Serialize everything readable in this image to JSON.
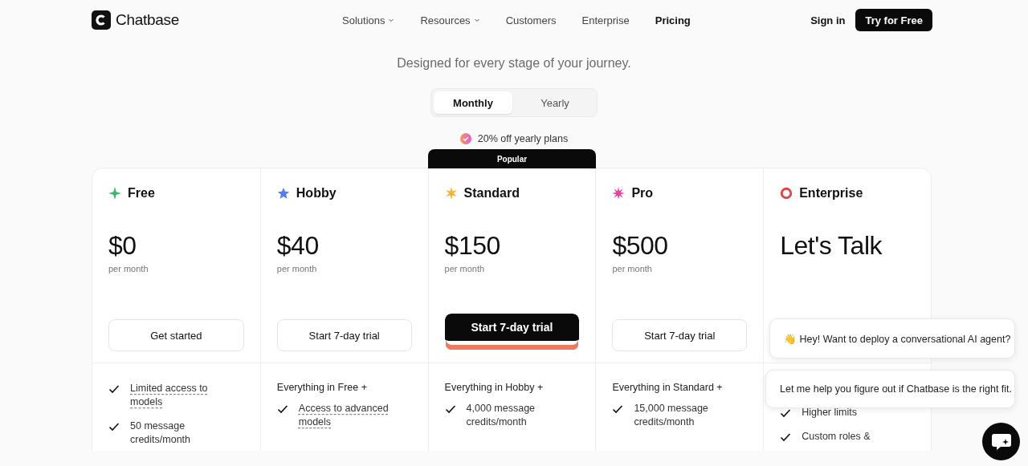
{
  "header": {
    "logo": "Chatbase",
    "nav": [
      {
        "label": "Solutions",
        "dropdown": true,
        "selected": false
      },
      {
        "label": "Resources",
        "dropdown": true,
        "selected": false
      },
      {
        "label": "Customers",
        "dropdown": false,
        "selected": false
      },
      {
        "label": "Enterprise",
        "dropdown": false,
        "selected": false
      },
      {
        "label": "Pricing",
        "dropdown": false,
        "selected": true
      }
    ],
    "sign_in": "Sign in",
    "cta": "Try for Free"
  },
  "subtitle": "Designed for every stage of your journey.",
  "billing_toggle": [
    {
      "label": "Monthly",
      "selected": true
    },
    {
      "label": "Yearly",
      "selected": false
    }
  ],
  "discount_note": "20% off yearly plans",
  "plans": [
    {
      "name": "Free",
      "color": "#3fb56b",
      "price": "$0",
      "period": "per month",
      "button": "Get started",
      "popular": false,
      "features": [
        {
          "text": "Limited access to models",
          "underlined": true
        },
        {
          "text": "50 message credits/month",
          "underlined": false
        }
      ]
    },
    {
      "name": "Hobby",
      "color": "#4f7ff0",
      "price": "$40",
      "period": "per month",
      "button": "Start 7-day trial",
      "popular": false,
      "intro": "Everything in Free +",
      "features": [
        {
          "text": "Access to advanced models",
          "underlined": true
        }
      ]
    },
    {
      "name": "Standard",
      "color": "#f5b335",
      "price": "$150",
      "period": "per month",
      "button": "Start 7-day trial",
      "popular": true,
      "badge": "Popular",
      "intro": "Everything in Hobby +",
      "features": [
        {
          "text": "4,000 message credits/month",
          "underlined": false
        }
      ]
    },
    {
      "name": "Pro",
      "color": "#ee3fa0",
      "price": "$500",
      "period": "per month",
      "button": "Start 7-day trial",
      "popular": false,
      "intro": "Everything in Standard +",
      "features": [
        {
          "text": "15,000 message credits/month",
          "underlined": false
        }
      ]
    },
    {
      "name": "Enterprise",
      "color": "#e04545",
      "price": "Let's Talk",
      "features": [
        {
          "text": "Higher limits",
          "underlined": false
        },
        {
          "text": "Custom roles &",
          "underlined": false
        }
      ]
    }
  ],
  "chat_bubbles": [
    "👋 Hey! Want to deploy a conversational AI agent?",
    "Let me help you figure out if Chatbase is the right fit."
  ]
}
